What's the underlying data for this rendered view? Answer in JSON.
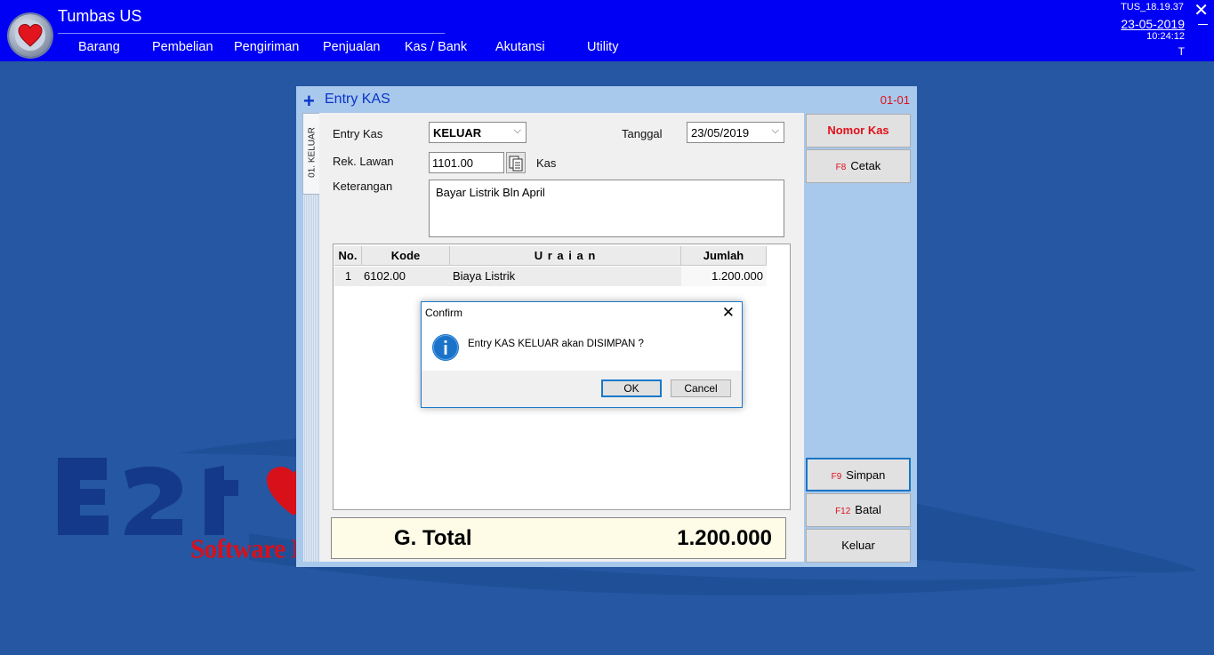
{
  "app": {
    "title": "Tumbas US",
    "system_code": "TUS_18.19.37",
    "date": "23-05-2019",
    "time": "10:24:12",
    "user": "T"
  },
  "menu": [
    "Barang",
    "Pembelian",
    "Pengiriman",
    "Penjualan",
    "Kas / Bank",
    "Akutansi",
    "Utility"
  ],
  "background": {
    "slogan": "Software House"
  },
  "window": {
    "title": "Entry KAS",
    "code": "01-01",
    "tab_label": "01. KELUAR"
  },
  "form": {
    "entry_kas_label": "Entry Kas",
    "entry_kas_value": "KELUAR",
    "tanggal_label": "Tanggal",
    "tanggal_value": "23/05/2019",
    "rek_lawan_label": "Rek. Lawan",
    "rek_lawan_value": "1101.00",
    "rek_lawan_name": "Kas",
    "keterangan_label": "Keterangan",
    "keterangan_value": "Bayar Listrik Bln April"
  },
  "grid": {
    "headers": [
      "No.",
      "Kode",
      "U r a i a n",
      "Jumlah"
    ],
    "rows": [
      [
        "1",
        "6102.00",
        "Biaya Listrik",
        "1.200.000"
      ]
    ]
  },
  "total": {
    "label": "G. Total",
    "value": "1.200.000"
  },
  "buttons": {
    "nomor_kas": "Nomor Kas",
    "cetak_key": "F8",
    "cetak": "Cetak",
    "simpan_key": "F9",
    "simpan": "Simpan",
    "batal_key": "F12",
    "batal": "Batal",
    "keluar": "Keluar"
  },
  "dialog": {
    "title": "Confirm",
    "message": "Entry KAS KELUAR akan DISIMPAN ?",
    "ok": "OK",
    "cancel": "Cancel"
  },
  "colors": {
    "topbar": "#0000f4",
    "desktop": "#2557a3",
    "accent_red": "#e0101a",
    "window_bg": "#a8c8ec"
  }
}
